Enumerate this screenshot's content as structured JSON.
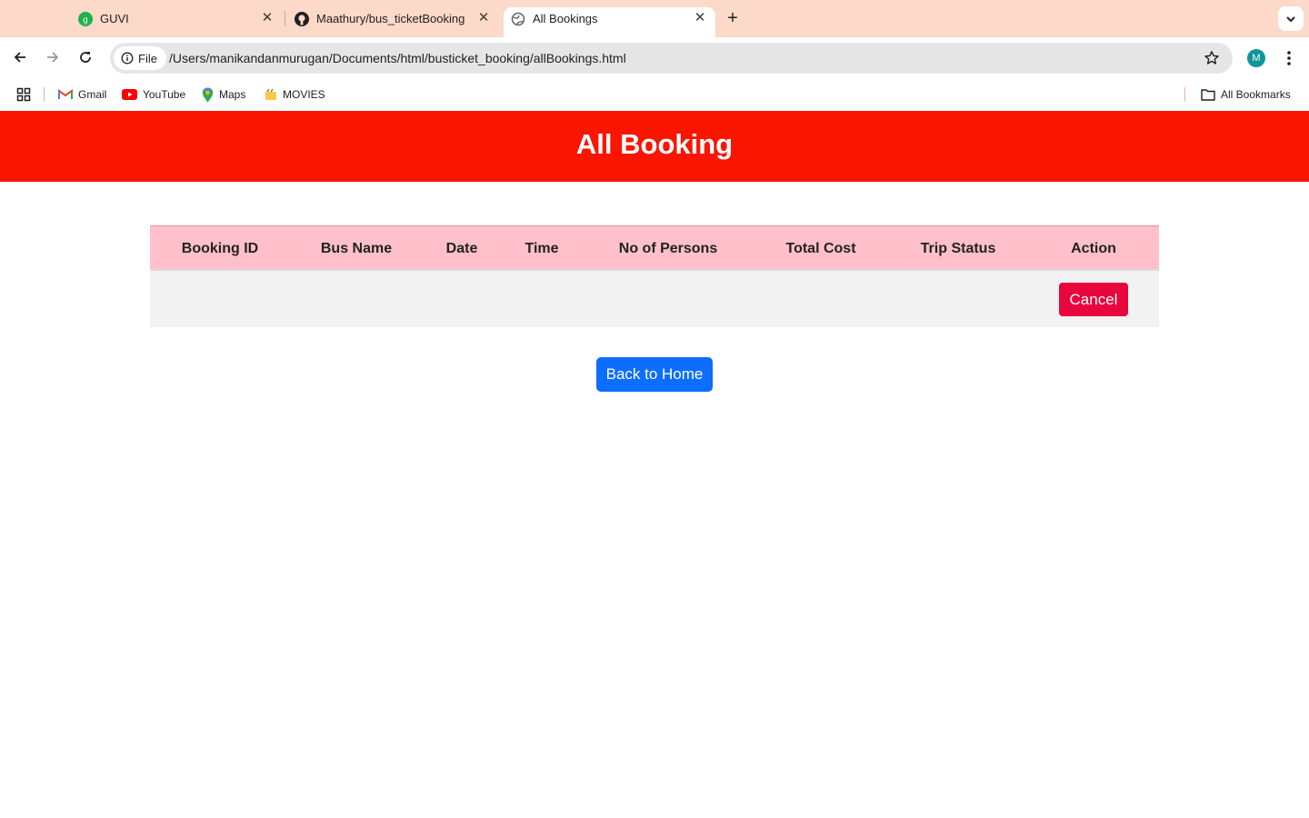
{
  "browser": {
    "tabs": [
      {
        "title": "GUVI",
        "favicon": "guvi-icon"
      },
      {
        "title": "Maathury/bus_ticketBooking",
        "favicon": "github-icon"
      },
      {
        "title": "All Bookings",
        "favicon": "globe-icon",
        "active": true
      }
    ],
    "address": {
      "chip_label": "File",
      "url": "/Users/manikandanmurugan/Documents/html/busticket_booking/allBookings.html"
    },
    "profile_initial": "M",
    "bookmarks": [
      {
        "label": "Gmail",
        "icon": "gmail-icon"
      },
      {
        "label": "YouTube",
        "icon": "youtube-icon"
      },
      {
        "label": "Maps",
        "icon": "maps-icon"
      },
      {
        "label": "MOVIES",
        "icon": "movies-icon"
      }
    ],
    "all_bookmarks_label": "All Bookmarks"
  },
  "page": {
    "title": "All Booking",
    "table": {
      "headers": [
        "Booking ID",
        "Bus Name",
        "Date",
        "Time",
        "No of Persons",
        "Total Cost",
        "Trip Status",
        "Action"
      ],
      "rows": [
        {
          "booking_id": "",
          "bus_name": "",
          "date": "",
          "time": "",
          "persons": "",
          "total_cost": "",
          "trip_status": "",
          "action_label": "Cancel"
        }
      ]
    },
    "back_home_label": "Back to Home"
  },
  "colors": {
    "header_bg": "#fa1500",
    "table_header_bg": "#ffc0cb",
    "row_bg": "#f2f2f2",
    "cancel_bg": "#e8063c",
    "home_bg": "#0d6efd",
    "tabstrip_bg": "#fdd9c9"
  }
}
